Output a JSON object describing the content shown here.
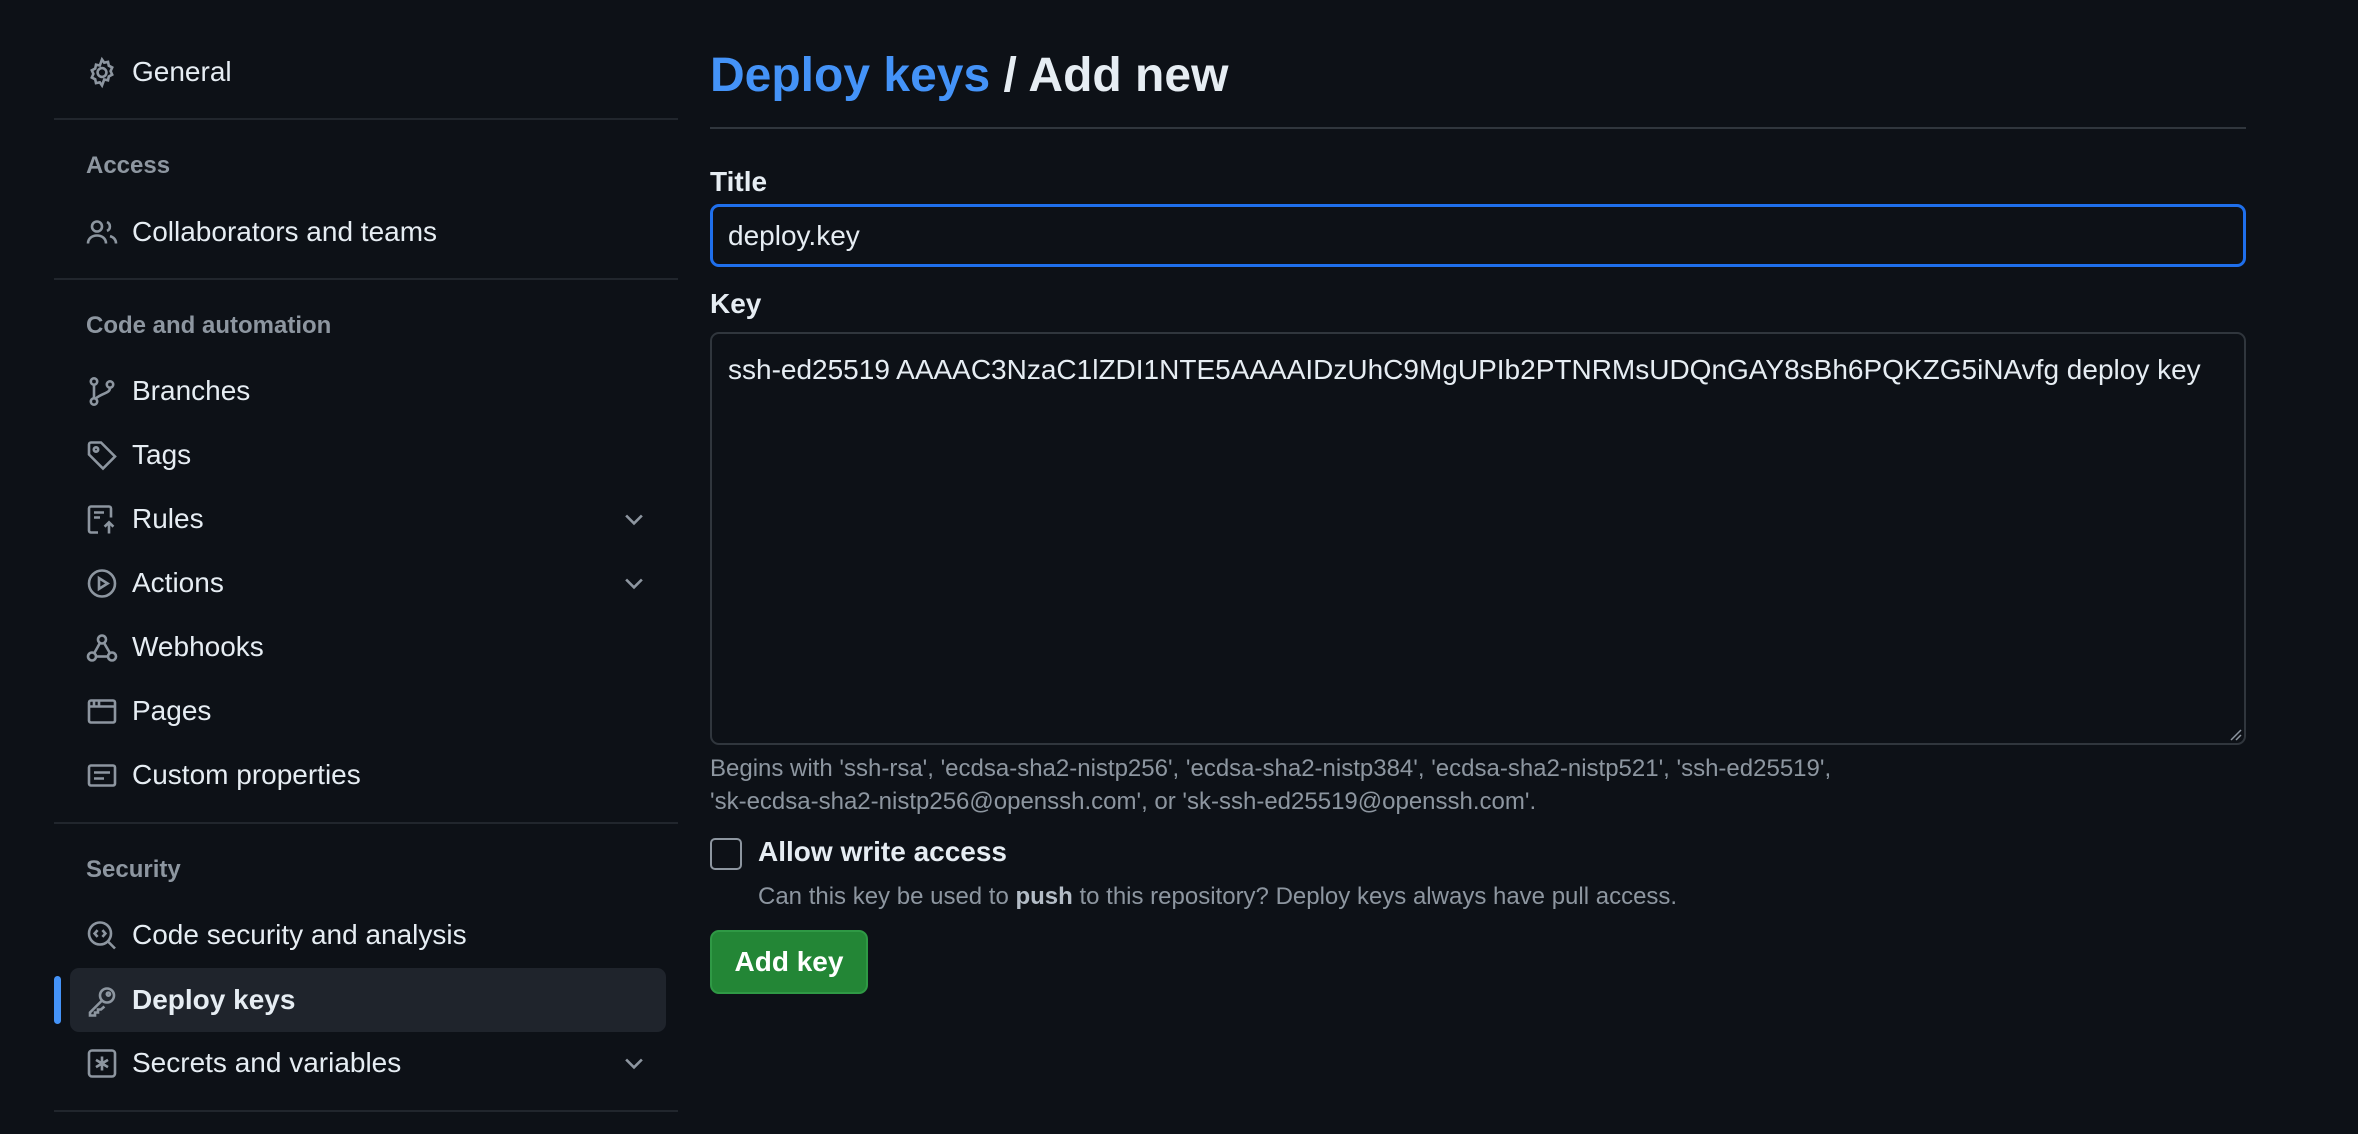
{
  "sidebar": {
    "general": {
      "label": "General",
      "icon": "gear-icon"
    },
    "sections": [
      {
        "heading": "Access"
      },
      {
        "heading": "Code and automation"
      },
      {
        "heading": "Security"
      }
    ],
    "items": [
      {
        "label": "Collaborators and teams",
        "icon": "people-icon"
      },
      {
        "label": "Branches",
        "icon": "branch-icon"
      },
      {
        "label": "Tags",
        "icon": "tag-icon"
      },
      {
        "label": "Rules",
        "icon": "rules-icon",
        "expandable": true
      },
      {
        "label": "Actions",
        "icon": "play-icon",
        "expandable": true
      },
      {
        "label": "Webhooks",
        "icon": "webhook-icon"
      },
      {
        "label": "Pages",
        "icon": "browser-icon"
      },
      {
        "label": "Custom properties",
        "icon": "note-icon"
      },
      {
        "label": "Code security and analysis",
        "icon": "codescan-icon"
      },
      {
        "label": "Deploy keys",
        "icon": "key-icon",
        "selected": true
      },
      {
        "label": "Secrets and variables",
        "icon": "asterisk-icon",
        "expandable": true
      }
    ]
  },
  "header": {
    "breadcrumb": "Deploy keys",
    "separator": "/",
    "current": "Add new"
  },
  "form": {
    "title_label": "Title",
    "title_value": "deploy.key",
    "key_label": "Key",
    "key_value": "ssh-ed25519 AAAAC3NzaC1lZDI1NTE5AAAAIDzUhC9MgUPIb2PTNRMsUDQnGAY8sBh6PQKZG5iNAvfg deploy key",
    "help_line1": "Begins with 'ssh-rsa', 'ecdsa-sha2-nistp256', 'ecdsa-sha2-nistp384', 'ecdsa-sha2-nistp521', 'ssh-ed25519',",
    "help_line2": "'sk-ecdsa-sha2-nistp256@openssh.com', or 'sk-ssh-ed25519@openssh.com'.",
    "write_access_label": "Allow write access",
    "write_access_checked": false,
    "write_access_desc_pre": "Can this key be used to ",
    "write_access_desc_bold": "push",
    "write_access_desc_post": " to this repository? Deploy keys always have pull access.",
    "submit_label": "Add key"
  },
  "colors": {
    "background": "#0d1117",
    "link": "#4493f8",
    "focus_border": "#1f6feb",
    "primary_button": "#238636",
    "muted_text": "#8d96a0"
  }
}
